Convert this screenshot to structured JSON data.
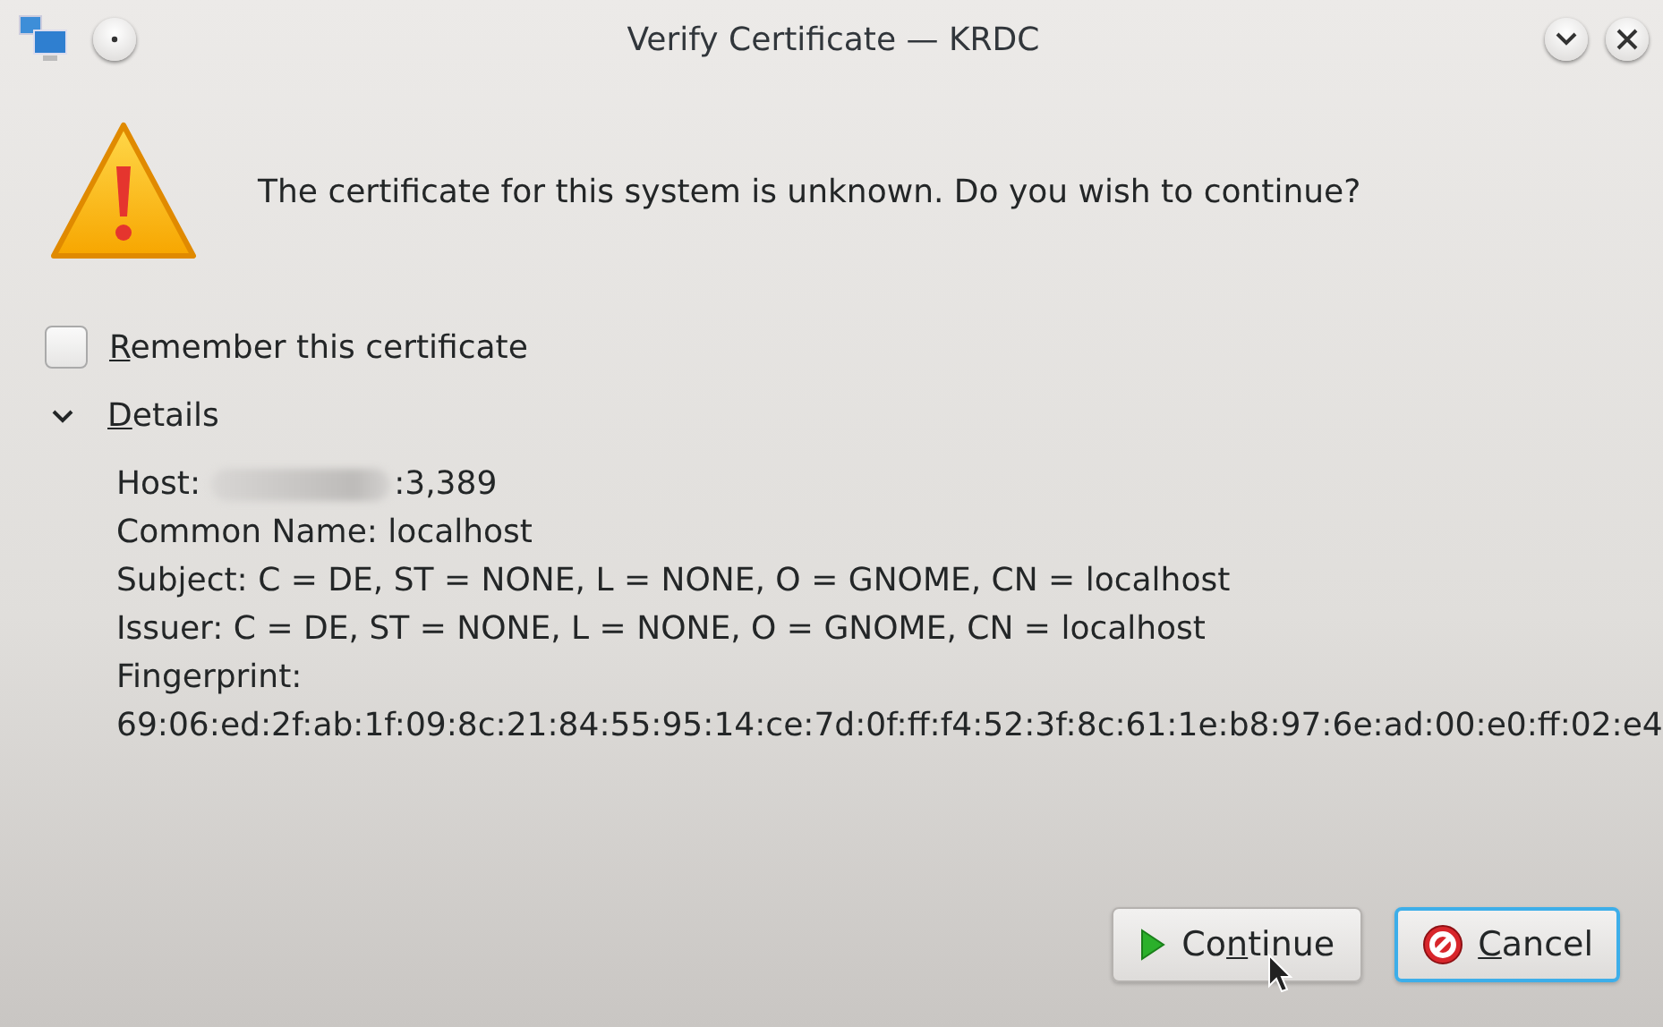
{
  "window": {
    "title": "Verify Certificate — KRDC"
  },
  "message": "The certificate for this system is unknown. Do you wish to continue?",
  "remember": {
    "label": [
      {
        "text": "R",
        "underlined": true
      },
      {
        "text": "emember this certificate",
        "underlined": false
      }
    ],
    "checked": false
  },
  "details": {
    "label": [
      {
        "text": "D",
        "underlined": true
      },
      {
        "text": "etails",
        "underlined": false
      }
    ],
    "expanded": true,
    "lines": [
      {
        "kind": "redacted",
        "before": "Host:",
        "after": ":3,389"
      },
      {
        "kind": "text",
        "text": "Common Name: localhost"
      },
      {
        "kind": "text",
        "text": "Subject: C = DE, ST = NONE, L = NONE, O = GNOME, CN = localhost"
      },
      {
        "kind": "text",
        "text": "Issuer: C = DE, ST = NONE, L = NONE, O = GNOME, CN = localhost"
      },
      {
        "kind": "text",
        "text": "Fingerprint:"
      },
      {
        "kind": "text",
        "text": "69:06:ed:2f:ab:1f:09:8c:21:84:55:95:14:ce:7d:0f:ff:f4:52:3f:8c:61:1e:b8:97:6e:ad:00:e0:ff:02:e4"
      }
    ]
  },
  "buttons": [
    {
      "kind": "continue",
      "label": [
        {
          "text": "Co",
          "underlined": false
        },
        {
          "text": "n",
          "underlined": true
        },
        {
          "text": "tinue",
          "underlined": false
        }
      ],
      "focused": false
    },
    {
      "kind": "cancel",
      "label": [
        {
          "text": "C",
          "underlined": true
        },
        {
          "text": "ancel",
          "underlined": false
        }
      ],
      "focused": true
    }
  ]
}
